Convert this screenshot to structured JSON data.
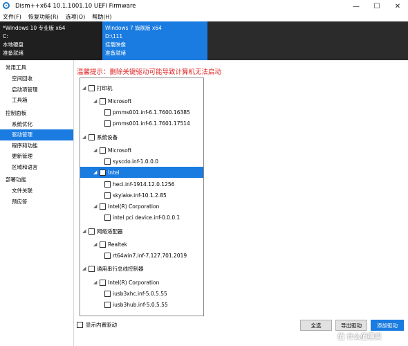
{
  "window": {
    "title": "Dism++x64 10.1.1001.10 UEFI Firmware",
    "controls": [
      "—",
      "☐",
      "✕"
    ]
  },
  "menu": [
    "文件(F)",
    "恢复功能(R)",
    "选项(O)",
    "帮助(H)"
  ],
  "sessions": [
    {
      "lines": [
        "*Windows 10 专业版 x64",
        "C:",
        "本地硬盘",
        "准备就绪"
      ]
    },
    {
      "lines": [
        "Windows 7 旗舰版 x64",
        "D:\\111",
        "挂载映像",
        "准备就绪"
      ]
    }
  ],
  "sidebar": {
    "groups": [
      {
        "title": "常用工具",
        "items": [
          "空间回收",
          "启动项管理",
          "工具箱"
        ]
      },
      {
        "title": "控制面板",
        "items": [
          "系统优化",
          "驱动管理",
          "程序和功能",
          "更新管理",
          "区域和语言"
        ]
      },
      {
        "title": "部署功能",
        "items": [
          "文件关联",
          "预应答"
        ]
      }
    ],
    "active": "驱动管理"
  },
  "warning": "温馨提示：删除关键驱动可能导致计算机无法启动",
  "tree": [
    "打印机",
    "Microsoft",
    "prnms001.inf-6.1.7600.16385",
    "prnms001.inf-6.1.7601.17514",
    "系统设备",
    "Microsoft",
    "syscdo.inf-1.0.0.0",
    "Intel",
    "heci.inf-1914.12.0.1256",
    "skylake.inf-10.1.2.85",
    "Intel(R) Corporation",
    "intel pci device.inf-0.0.0.1",
    "网络适配器",
    "Realtek",
    "rt64win7.inf-7.127.701.2019",
    "通用串行总线控制器",
    "Intel(R) Corporation",
    "iusb3xhc.inf-5.0.5.55",
    "iusb3hub.inf-5.0.5.55"
  ],
  "show_builtin": "显示内置驱动",
  "buttons": {
    "select_all": "全选",
    "export": "导出驱动",
    "add": "添加驱动"
  },
  "watermark": "值 什么值得买",
  "colors": {
    "accent": "#1a7be0",
    "warning": "#e02020"
  }
}
